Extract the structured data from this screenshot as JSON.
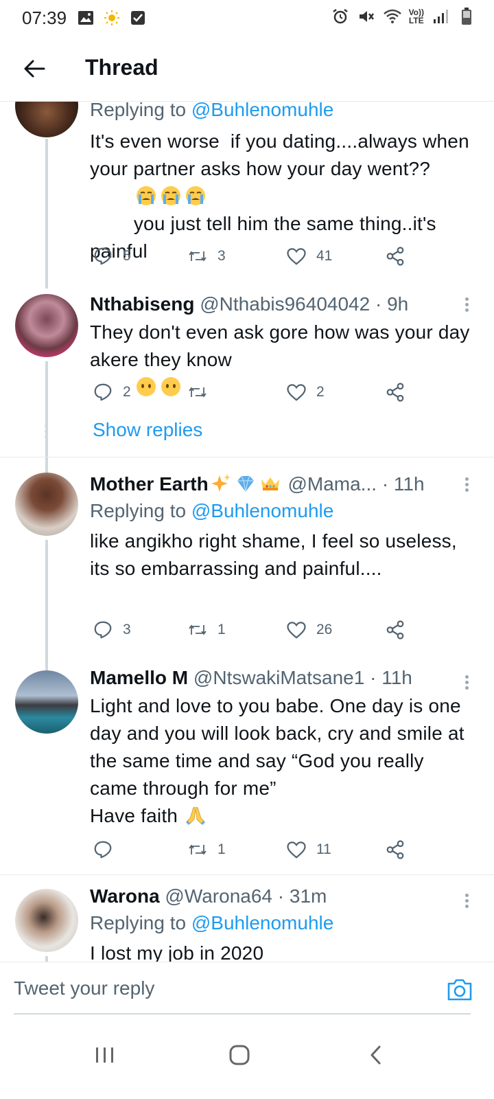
{
  "status_bar": {
    "time": "07:39",
    "network": "Vo))\nLTE"
  },
  "header": {
    "title": "Thread"
  },
  "tweets": [
    {
      "name": "",
      "handle": "",
      "time": "",
      "replying_prefix": "Replying to ",
      "replying_to": "@Buhlenomuhle",
      "text_parts": [
        "It's even worse  if you dating....always when your partner asks how your day went??",
        "you just tell him the same thing..it's painful"
      ],
      "replies": "5",
      "retweets": "3",
      "likes": "41"
    },
    {
      "name": "Nthabiseng",
      "handle": "@Nthabis96404042",
      "time": "· 9h",
      "text_parts": [
        "They don't even ask gore how was your day akere they know"
      ],
      "replies": "2",
      "retweets": "",
      "likes": "2"
    },
    {
      "name": "Mother Earth",
      "handle": "@Mama...",
      "time": "· 11h",
      "replying_prefix": "Replying to ",
      "replying_to": "@Buhlenomuhle",
      "text_parts": [
        "like angikho right shame, I feel so useless, its so embarrassing and painful...."
      ],
      "replies": "3",
      "retweets": "1",
      "likes": "26"
    },
    {
      "name": "Mamello M",
      "handle": "@NtswakiMatsane1",
      "time": "· 11h",
      "text_parts": [
        "Light and love to you babe. One day is one day and you will look back, cry and smile at the same time and say “God you really came through for me”",
        "Have faith"
      ],
      "replies": "",
      "retweets": "1",
      "likes": "11"
    },
    {
      "name": "Warona",
      "handle": "@Warona64",
      "time": "· 31m",
      "replying_prefix": "Replying to ",
      "replying_to": "@Buhlenomuhle",
      "text_parts": [
        "I lost my job in 2020"
      ]
    }
  ],
  "show_replies": "Show replies",
  "reply_bar": {
    "placeholder": "Tweet your reply"
  },
  "colors": {
    "accent": "#1d9bf0",
    "text": "#0f1419",
    "muted": "#536471",
    "divider": "#e6e9ec"
  }
}
